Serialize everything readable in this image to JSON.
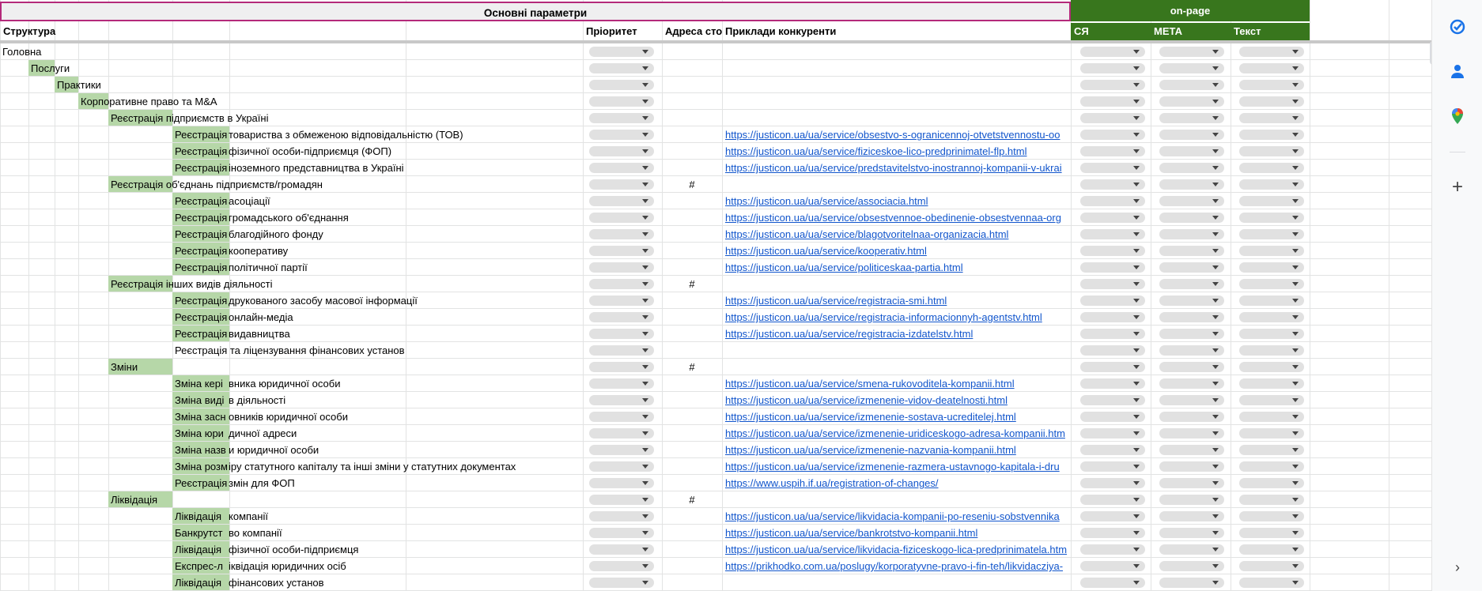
{
  "header": {
    "main_params": "Основні параметри",
    "onpage": "on-page",
    "columns": {
      "structure": "Структура",
      "priority": "Пріоритет",
      "address": "Адреса сто",
      "competitors": "Приклади конкуренти",
      "sya": "СЯ",
      "meta": "МЕТА",
      "text": "Текст"
    }
  },
  "rows": [
    {
      "level": 0,
      "label": "Головна",
      "hl": false,
      "hash": "",
      "link": ""
    },
    {
      "level": 1,
      "label": "Послуги",
      "hl": true,
      "hash": "",
      "link": ""
    },
    {
      "level": 2,
      "label": "Практики",
      "hl": true,
      "hash": "",
      "link": ""
    },
    {
      "level": 3,
      "label": "Корпоративне право та M&A",
      "hl": true,
      "hash": "",
      "link": ""
    },
    {
      "level": 4,
      "label": "Реєстрація підприємств в Україні",
      "hl": true,
      "hash": "",
      "link": ""
    },
    {
      "level": 5,
      "label": "Реєстрація",
      "rest": "товариства з обмеженою відповідальністю (ТОВ)",
      "hl": true,
      "hash": "",
      "link": "https://justicon.ua/ua/service/obsestvo-s-ogranicennoj-otvetstvennostu-oo"
    },
    {
      "level": 5,
      "label": "Реєстрація",
      "rest": "фізичної особи-підприємця (ФОП)",
      "hl": true,
      "hash": "",
      "link": "https://justicon.ua/ua/service/fiziceskoe-lico-predprinimatel-flp.html"
    },
    {
      "level": 5,
      "label": "Реєстрація",
      "rest": "іноземного представництва в Україні",
      "hl": true,
      "hash": "",
      "link": "https://justicon.ua/ua/service/predstavitelstvo-inostrannoj-kompanii-v-ukrai"
    },
    {
      "level": 4,
      "label": "Реєстрація об'єднань підприємств/громадян",
      "hl": true,
      "hash": "#",
      "link": ""
    },
    {
      "level": 5,
      "label": "Реєстрація",
      "rest": "асоціації",
      "hl": true,
      "hash": "",
      "link": "https://justicon.ua/ua/service/associacia.html"
    },
    {
      "level": 5,
      "label": "Реєстрація",
      "rest": "громадського об'єднання",
      "hl": true,
      "hash": "",
      "link": "https://justicon.ua/ua/service/obsestvennoe-obedinenie-obsestvennaa-org"
    },
    {
      "level": 5,
      "label": "Реєстрація",
      "rest": "благодійного фонду",
      "hl": true,
      "hash": "",
      "link": "https://justicon.ua/ua/service/blagotvoritelnaa-organizacia.html"
    },
    {
      "level": 5,
      "label": "Реєстрація",
      "rest": "кооперативу",
      "hl": true,
      "hash": "",
      "link": "https://justicon.ua/ua/service/kooperativ.html"
    },
    {
      "level": 5,
      "label": "Реєстрація",
      "rest": "політичної партії",
      "hl": true,
      "hash": "",
      "link": "https://justicon.ua/ua/service/politiceskaa-partia.html"
    },
    {
      "level": 4,
      "label": "Реєстрація інших видів діяльності",
      "hl": true,
      "hash": "#",
      "link": ""
    },
    {
      "level": 5,
      "label": "Реєстрація",
      "rest": "друкованого засобу масової інформації",
      "hl": true,
      "hash": "",
      "link": "https://justicon.ua/ua/service/registracia-smi.html"
    },
    {
      "level": 5,
      "label": "Реєстрація",
      "rest": "онлайн-медіа",
      "hl": true,
      "hash": "",
      "link": "https://justicon.ua/ua/service/registracia-informacionnyh-agentstv.html"
    },
    {
      "level": 5,
      "label": "Реєстрація",
      "rest": "видавництва",
      "hl": true,
      "hash": "",
      "link": "https://justicon.ua/ua/service/registracia-izdatelstv.html"
    },
    {
      "level": 5,
      "label": "Реєстрація та ліцензування фінансових установ",
      "hl": false,
      "hash": "",
      "link": ""
    },
    {
      "level": 4,
      "label": "Зміни",
      "hl": true,
      "hash": "#",
      "link": ""
    },
    {
      "level": 5,
      "label": "Зміна кері",
      "rest": "вника юридичної особи",
      "hl": true,
      "hash": "",
      "link": "https://justicon.ua/ua/service/smena-rukovoditela-kompanii.html"
    },
    {
      "level": 5,
      "label": "Зміна виді",
      "rest": "в діяльності",
      "hl": true,
      "hash": "",
      "link": "https://justicon.ua/ua/service/izmenenie-vidov-deatelnosti.html"
    },
    {
      "level": 5,
      "label": "Зміна засн",
      "rest": "овників юридичної особи",
      "hl": true,
      "hash": "",
      "link": "https://justicon.ua/ua/service/izmenenie-sostava-ucreditelej.html"
    },
    {
      "level": 5,
      "label": "Зміна юри",
      "rest": "дичної адреси",
      "hl": true,
      "hash": "",
      "link": "https://justicon.ua/ua/service/izmenenie-uridiceskogo-adresa-kompanii.htm"
    },
    {
      "level": 5,
      "label": "Зміна назв",
      "rest": "и юридичної особи",
      "hl": true,
      "hash": "",
      "link": "https://justicon.ua/ua/service/izmenenie-nazvania-kompanii.html"
    },
    {
      "level": 5,
      "label": "Зміна розм",
      "rest": "іру статутного капіталу та інші зміни у статутних документах",
      "hl": true,
      "hash": "",
      "link": "https://justicon.ua/ua/service/izmenenie-razmera-ustavnogo-kapitala-i-dru"
    },
    {
      "level": 5,
      "label": "Реєстрація",
      "rest": "змін для ФОП",
      "hl": true,
      "hash": "",
      "link": "https://www.uspih.if.ua/registration-of-changes/"
    },
    {
      "level": 4,
      "label": "Ліквідація",
      "hl": true,
      "hash": "#",
      "link": ""
    },
    {
      "level": 5,
      "label": "Ліквідація",
      "rest": "компанії",
      "hl": true,
      "hash": "",
      "link": "https://justicon.ua/ua/service/likvidacia-kompanii-po-reseniu-sobstvennika"
    },
    {
      "level": 5,
      "label": "Банкрутст",
      "rest": "во компанії",
      "hl": true,
      "hash": "",
      "link": "https://justicon.ua/ua/service/bankrotstvo-kompanii.html"
    },
    {
      "level": 5,
      "label": "Ліквідація",
      "rest": "фізичної особи-підприємця",
      "hl": true,
      "hash": "",
      "link": "https://justicon.ua/ua/service/likvidacia-fiziceskogo-lica-predprinimatela.htm"
    },
    {
      "level": 5,
      "label": "Експрес-л",
      "rest": "іквідація юридичних осіб",
      "hl": true,
      "hash": "",
      "link": "https://prikhodko.com.ua/poslugy/korporatyvne-pravo-i-fin-teh/likvidacziya-"
    },
    {
      "level": 5,
      "label": "Ліквідація",
      "rest": "фінансових установ",
      "hl": true,
      "hash": "",
      "link": ""
    }
  ],
  "side_panel": [
    {
      "name": "tasks-icon",
      "color": "#1a73e8"
    },
    {
      "name": "contacts-icon",
      "color": "#1a73e8"
    },
    {
      "name": "maps-icon",
      "color": "#34a853"
    },
    {
      "name": "add-icon",
      "color": "#444444"
    },
    {
      "name": "chevron-right-icon",
      "color": "#444444"
    }
  ]
}
